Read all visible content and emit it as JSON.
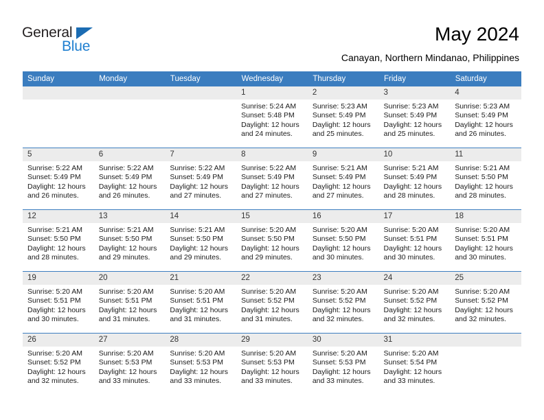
{
  "brand": {
    "name_dark": "General",
    "name_blue": "Blue",
    "color_blue": "#1f7fd0",
    "color_triangle": "#1b6cb3"
  },
  "header": {
    "title": "May 2024",
    "subtitle": "Canayan, Northern Mindanao, Philippines",
    "header_bg": "#3b7dbf",
    "daynum_bg": "#ececec"
  },
  "weekdays": [
    "Sunday",
    "Monday",
    "Tuesday",
    "Wednesday",
    "Thursday",
    "Friday",
    "Saturday"
  ],
  "weeks": [
    [
      {
        "day": "",
        "empty": true,
        "sunrise": "",
        "sunset": "",
        "daylight1": "",
        "daylight2": ""
      },
      {
        "day": "",
        "empty": true,
        "sunrise": "",
        "sunset": "",
        "daylight1": "",
        "daylight2": ""
      },
      {
        "day": "",
        "empty": true,
        "sunrise": "",
        "sunset": "",
        "daylight1": "",
        "daylight2": ""
      },
      {
        "day": "1",
        "empty": false,
        "sunrise": "Sunrise: 5:24 AM",
        "sunset": "Sunset: 5:48 PM",
        "daylight1": "Daylight: 12 hours",
        "daylight2": "and 24 minutes."
      },
      {
        "day": "2",
        "empty": false,
        "sunrise": "Sunrise: 5:23 AM",
        "sunset": "Sunset: 5:49 PM",
        "daylight1": "Daylight: 12 hours",
        "daylight2": "and 25 minutes."
      },
      {
        "day": "3",
        "empty": false,
        "sunrise": "Sunrise: 5:23 AM",
        "sunset": "Sunset: 5:49 PM",
        "daylight1": "Daylight: 12 hours",
        "daylight2": "and 25 minutes."
      },
      {
        "day": "4",
        "empty": false,
        "sunrise": "Sunrise: 5:23 AM",
        "sunset": "Sunset: 5:49 PM",
        "daylight1": "Daylight: 12 hours",
        "daylight2": "and 26 minutes."
      }
    ],
    [
      {
        "day": "5",
        "empty": false,
        "sunrise": "Sunrise: 5:22 AM",
        "sunset": "Sunset: 5:49 PM",
        "daylight1": "Daylight: 12 hours",
        "daylight2": "and 26 minutes."
      },
      {
        "day": "6",
        "empty": false,
        "sunrise": "Sunrise: 5:22 AM",
        "sunset": "Sunset: 5:49 PM",
        "daylight1": "Daylight: 12 hours",
        "daylight2": "and 26 minutes."
      },
      {
        "day": "7",
        "empty": false,
        "sunrise": "Sunrise: 5:22 AM",
        "sunset": "Sunset: 5:49 PM",
        "daylight1": "Daylight: 12 hours",
        "daylight2": "and 27 minutes."
      },
      {
        "day": "8",
        "empty": false,
        "sunrise": "Sunrise: 5:22 AM",
        "sunset": "Sunset: 5:49 PM",
        "daylight1": "Daylight: 12 hours",
        "daylight2": "and 27 minutes."
      },
      {
        "day": "9",
        "empty": false,
        "sunrise": "Sunrise: 5:21 AM",
        "sunset": "Sunset: 5:49 PM",
        "daylight1": "Daylight: 12 hours",
        "daylight2": "and 27 minutes."
      },
      {
        "day": "10",
        "empty": false,
        "sunrise": "Sunrise: 5:21 AM",
        "sunset": "Sunset: 5:49 PM",
        "daylight1": "Daylight: 12 hours",
        "daylight2": "and 28 minutes."
      },
      {
        "day": "11",
        "empty": false,
        "sunrise": "Sunrise: 5:21 AM",
        "sunset": "Sunset: 5:50 PM",
        "daylight1": "Daylight: 12 hours",
        "daylight2": "and 28 minutes."
      }
    ],
    [
      {
        "day": "12",
        "empty": false,
        "sunrise": "Sunrise: 5:21 AM",
        "sunset": "Sunset: 5:50 PM",
        "daylight1": "Daylight: 12 hours",
        "daylight2": "and 28 minutes."
      },
      {
        "day": "13",
        "empty": false,
        "sunrise": "Sunrise: 5:21 AM",
        "sunset": "Sunset: 5:50 PM",
        "daylight1": "Daylight: 12 hours",
        "daylight2": "and 29 minutes."
      },
      {
        "day": "14",
        "empty": false,
        "sunrise": "Sunrise: 5:21 AM",
        "sunset": "Sunset: 5:50 PM",
        "daylight1": "Daylight: 12 hours",
        "daylight2": "and 29 minutes."
      },
      {
        "day": "15",
        "empty": false,
        "sunrise": "Sunrise: 5:20 AM",
        "sunset": "Sunset: 5:50 PM",
        "daylight1": "Daylight: 12 hours",
        "daylight2": "and 29 minutes."
      },
      {
        "day": "16",
        "empty": false,
        "sunrise": "Sunrise: 5:20 AM",
        "sunset": "Sunset: 5:50 PM",
        "daylight1": "Daylight: 12 hours",
        "daylight2": "and 30 minutes."
      },
      {
        "day": "17",
        "empty": false,
        "sunrise": "Sunrise: 5:20 AM",
        "sunset": "Sunset: 5:51 PM",
        "daylight1": "Daylight: 12 hours",
        "daylight2": "and 30 minutes."
      },
      {
        "day": "18",
        "empty": false,
        "sunrise": "Sunrise: 5:20 AM",
        "sunset": "Sunset: 5:51 PM",
        "daylight1": "Daylight: 12 hours",
        "daylight2": "and 30 minutes."
      }
    ],
    [
      {
        "day": "19",
        "empty": false,
        "sunrise": "Sunrise: 5:20 AM",
        "sunset": "Sunset: 5:51 PM",
        "daylight1": "Daylight: 12 hours",
        "daylight2": "and 30 minutes."
      },
      {
        "day": "20",
        "empty": false,
        "sunrise": "Sunrise: 5:20 AM",
        "sunset": "Sunset: 5:51 PM",
        "daylight1": "Daylight: 12 hours",
        "daylight2": "and 31 minutes."
      },
      {
        "day": "21",
        "empty": false,
        "sunrise": "Sunrise: 5:20 AM",
        "sunset": "Sunset: 5:51 PM",
        "daylight1": "Daylight: 12 hours",
        "daylight2": "and 31 minutes."
      },
      {
        "day": "22",
        "empty": false,
        "sunrise": "Sunrise: 5:20 AM",
        "sunset": "Sunset: 5:52 PM",
        "daylight1": "Daylight: 12 hours",
        "daylight2": "and 31 minutes."
      },
      {
        "day": "23",
        "empty": false,
        "sunrise": "Sunrise: 5:20 AM",
        "sunset": "Sunset: 5:52 PM",
        "daylight1": "Daylight: 12 hours",
        "daylight2": "and 32 minutes."
      },
      {
        "day": "24",
        "empty": false,
        "sunrise": "Sunrise: 5:20 AM",
        "sunset": "Sunset: 5:52 PM",
        "daylight1": "Daylight: 12 hours",
        "daylight2": "and 32 minutes."
      },
      {
        "day": "25",
        "empty": false,
        "sunrise": "Sunrise: 5:20 AM",
        "sunset": "Sunset: 5:52 PM",
        "daylight1": "Daylight: 12 hours",
        "daylight2": "and 32 minutes."
      }
    ],
    [
      {
        "day": "26",
        "empty": false,
        "sunrise": "Sunrise: 5:20 AM",
        "sunset": "Sunset: 5:52 PM",
        "daylight1": "Daylight: 12 hours",
        "daylight2": "and 32 minutes."
      },
      {
        "day": "27",
        "empty": false,
        "sunrise": "Sunrise: 5:20 AM",
        "sunset": "Sunset: 5:53 PM",
        "daylight1": "Daylight: 12 hours",
        "daylight2": "and 33 minutes."
      },
      {
        "day": "28",
        "empty": false,
        "sunrise": "Sunrise: 5:20 AM",
        "sunset": "Sunset: 5:53 PM",
        "daylight1": "Daylight: 12 hours",
        "daylight2": "and 33 minutes."
      },
      {
        "day": "29",
        "empty": false,
        "sunrise": "Sunrise: 5:20 AM",
        "sunset": "Sunset: 5:53 PM",
        "daylight1": "Daylight: 12 hours",
        "daylight2": "and 33 minutes."
      },
      {
        "day": "30",
        "empty": false,
        "sunrise": "Sunrise: 5:20 AM",
        "sunset": "Sunset: 5:53 PM",
        "daylight1": "Daylight: 12 hours",
        "daylight2": "and 33 minutes."
      },
      {
        "day": "31",
        "empty": false,
        "sunrise": "Sunrise: 5:20 AM",
        "sunset": "Sunset: 5:54 PM",
        "daylight1": "Daylight: 12 hours",
        "daylight2": "and 33 minutes."
      },
      {
        "day": "",
        "empty": true,
        "sunrise": "",
        "sunset": "",
        "daylight1": "",
        "daylight2": ""
      }
    ]
  ]
}
